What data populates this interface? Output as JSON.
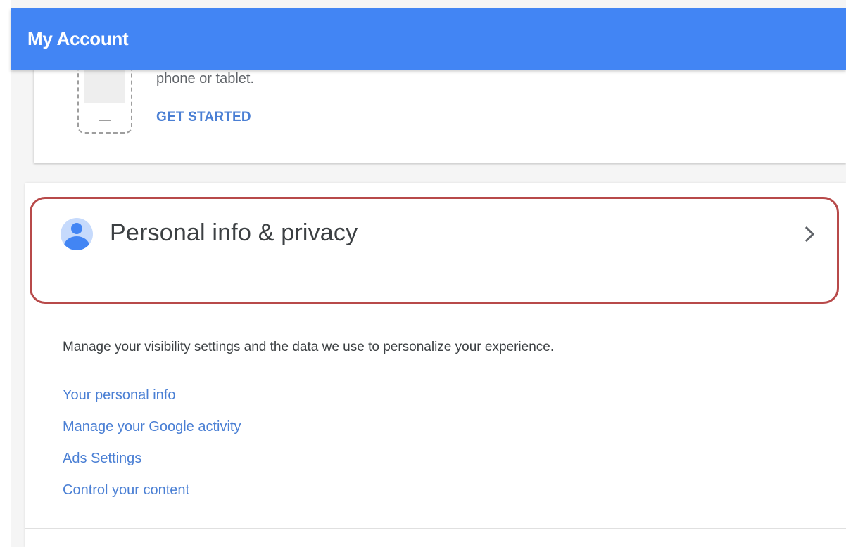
{
  "appbar": {
    "title": "My Account",
    "color": "#4285f4"
  },
  "device_card": {
    "text": "phone or tablet.",
    "action_label": "GET STARTED"
  },
  "privacy_card": {
    "title": "Personal info & privacy",
    "icon": "person-icon",
    "chevron_icon": "chevron-right-icon",
    "description": "Manage your visibility settings and the data we use to personalize your experience.",
    "links": [
      "Your personal info",
      "Manage your Google activity",
      "Ads Settings",
      "Control your content"
    ],
    "highlight_color": "#b84a4a"
  },
  "colors": {
    "link": "#4a7fd4",
    "text": "#3c4043"
  }
}
